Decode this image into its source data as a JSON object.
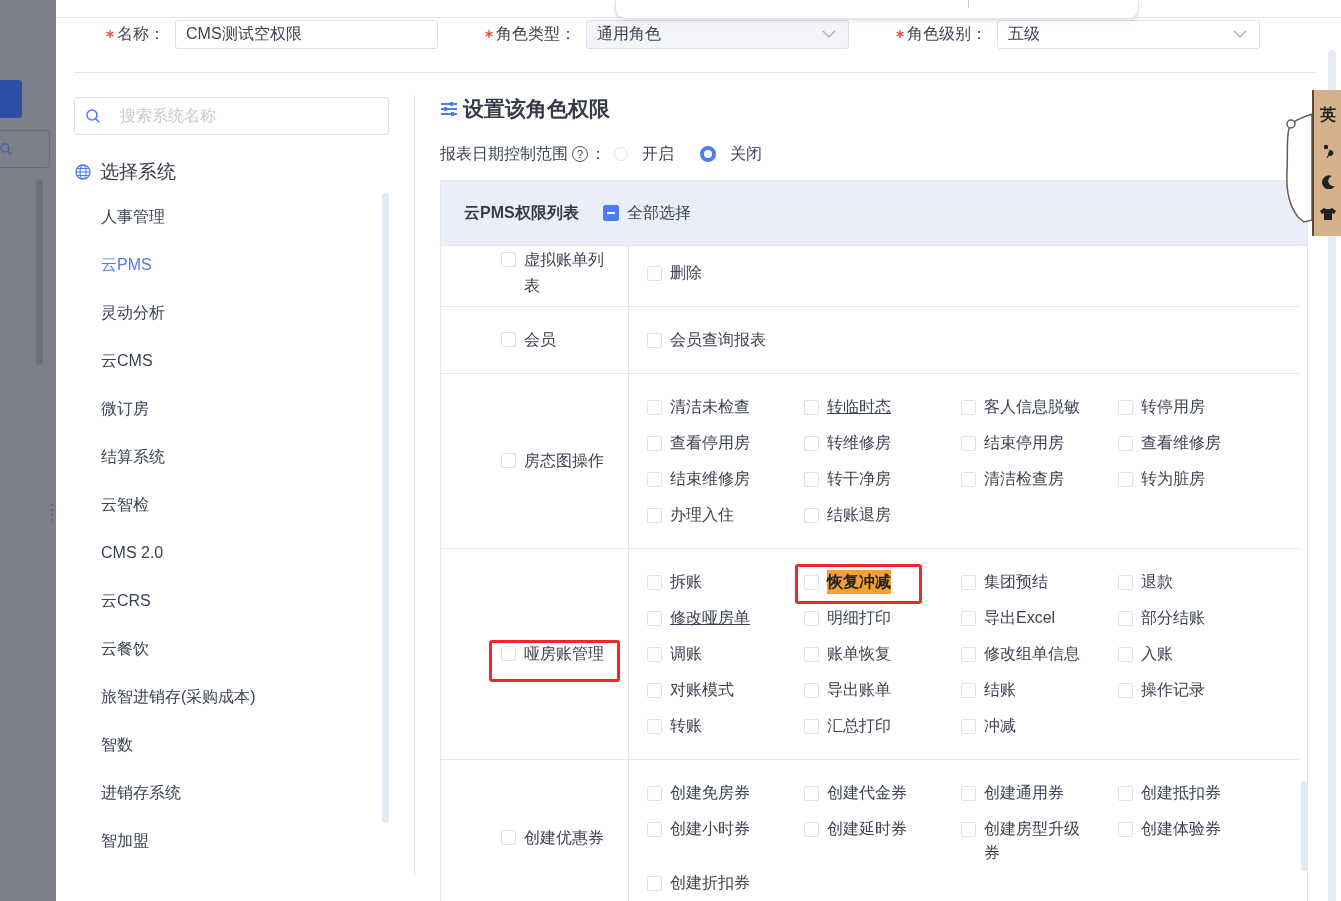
{
  "form": {
    "fields": [
      {
        "label": "名称：",
        "required": true,
        "kind": "input",
        "value": "CMS测试空权限",
        "disabled": false
      },
      {
        "label": "角色类型：",
        "required": true,
        "kind": "select",
        "value": "通用角色",
        "disabled": true
      },
      {
        "label": "角色级别：",
        "required": true,
        "kind": "select",
        "value": "五级",
        "disabled": false
      }
    ]
  },
  "system_panel": {
    "search": {
      "placeholder": "搜索系统名称"
    },
    "title": "选择系统",
    "items": [
      {
        "label": "人事管理",
        "selected": false
      },
      {
        "label": "云PMS",
        "selected": true
      },
      {
        "label": "灵动分析",
        "selected": false
      },
      {
        "label": "云CMS",
        "selected": false
      },
      {
        "label": "微订房",
        "selected": false
      },
      {
        "label": "结算系统",
        "selected": false
      },
      {
        "label": "云智检",
        "selected": false
      },
      {
        "label": "CMS 2.0",
        "selected": false
      },
      {
        "label": "云CRS",
        "selected": false
      },
      {
        "label": "云餐饮",
        "selected": false
      },
      {
        "label": "旅智进销存(采购成本)",
        "selected": false
      },
      {
        "label": "智数",
        "selected": false
      },
      {
        "label": "进销存系统",
        "selected": false
      },
      {
        "label": "智加盟",
        "selected": false
      }
    ]
  },
  "permissions": {
    "title": "设置该角色权限",
    "date_range": {
      "label": "报表日期控制范围",
      "help_icon": "?",
      "separator": "：",
      "options": [
        {
          "label": "开启",
          "selected": false
        },
        {
          "label": "关闭",
          "selected": true
        }
      ]
    },
    "table": {
      "title": "云PMS权限列表",
      "select_all": {
        "label": "全部选择",
        "indeterminate": true
      },
      "rows": [
        {
          "label": "虚拟账单列表",
          "checked": false,
          "annotated": false,
          "items": [
            {
              "label": "删除",
              "checked": false,
              "kind": "plain",
              "annotated": false
            }
          ]
        },
        {
          "label": "会员",
          "checked": false,
          "annotated": false,
          "items": [
            {
              "label": "会员查询报表",
              "checked": false,
              "kind": "plain",
              "annotated": false
            }
          ]
        },
        {
          "label": "房态图操作",
          "checked": false,
          "annotated": false,
          "items": [
            {
              "label": "清洁未检查",
              "checked": false,
              "kind": "plain",
              "annotated": false
            },
            {
              "label": "转临时态",
              "checked": false,
              "kind": "underlined",
              "annotated": false
            },
            {
              "label": "客人信息脱敏",
              "checked": false,
              "kind": "plain",
              "annotated": false
            },
            {
              "label": "转停用房",
              "checked": false,
              "kind": "plain",
              "annotated": false
            },
            {
              "label": "查看停用房",
              "checked": false,
              "kind": "plain",
              "annotated": false
            },
            {
              "label": "转维修房",
              "checked": false,
              "kind": "plain",
              "annotated": false
            },
            {
              "label": "结束停用房",
              "checked": false,
              "kind": "plain",
              "annotated": false
            },
            {
              "label": "查看维修房",
              "checked": false,
              "kind": "plain",
              "annotated": false
            },
            {
              "label": "结束维修房",
              "checked": false,
              "kind": "plain",
              "annotated": false
            },
            {
              "label": "转干净房",
              "checked": false,
              "kind": "plain",
              "annotated": false
            },
            {
              "label": "清洁检查房",
              "checked": false,
              "kind": "plain",
              "annotated": false
            },
            {
              "label": "转为脏房",
              "checked": false,
              "kind": "plain",
              "annotated": false
            },
            {
              "label": "办理入住",
              "checked": false,
              "kind": "plain",
              "annotated": false
            },
            {
              "label": "结账退房",
              "checked": false,
              "kind": "plain",
              "annotated": false
            }
          ]
        },
        {
          "label": "哑房账管理",
          "checked": false,
          "annotated": true,
          "items": [
            {
              "label": "拆账",
              "checked": false,
              "kind": "plain",
              "annotated": false
            },
            {
              "label": "恢复冲减",
              "checked": false,
              "kind": "highlighted",
              "annotated": true
            },
            {
              "label": "集团预结",
              "checked": false,
              "kind": "plain",
              "annotated": false
            },
            {
              "label": "退款",
              "checked": false,
              "kind": "plain",
              "annotated": false
            },
            {
              "label": "修改哑房单",
              "checked": false,
              "kind": "underlined",
              "annotated": false
            },
            {
              "label": "明细打印",
              "checked": false,
              "kind": "plain",
              "annotated": false
            },
            {
              "label": "导出Excel",
              "checked": false,
              "kind": "plain",
              "annotated": false
            },
            {
              "label": "部分结账",
              "checked": false,
              "kind": "plain",
              "annotated": false
            },
            {
              "label": "调账",
              "checked": false,
              "kind": "plain",
              "annotated": false
            },
            {
              "label": "账单恢复",
              "checked": false,
              "kind": "plain",
              "annotated": false
            },
            {
              "label": "修改组单信息",
              "checked": false,
              "kind": "plain",
              "annotated": false
            },
            {
              "label": "入账",
              "checked": false,
              "kind": "plain",
              "annotated": false
            },
            {
              "label": "对账模式",
              "checked": false,
              "kind": "plain",
              "annotated": false
            },
            {
              "label": "导出账单",
              "checked": false,
              "kind": "plain",
              "annotated": false
            },
            {
              "label": "结账",
              "checked": false,
              "kind": "plain",
              "annotated": false
            },
            {
              "label": "操作记录",
              "checked": false,
              "kind": "plain",
              "annotated": false
            },
            {
              "label": "转账",
              "checked": false,
              "kind": "plain",
              "annotated": false
            },
            {
              "label": "汇总打印",
              "checked": false,
              "kind": "plain",
              "annotated": false
            },
            {
              "label": "冲减",
              "checked": false,
              "kind": "plain",
              "annotated": false
            }
          ]
        },
        {
          "label": "创建优惠券",
          "checked": false,
          "annotated": false,
          "items": [
            {
              "label": "创建免房券",
              "checked": false,
              "kind": "plain",
              "annotated": false
            },
            {
              "label": "创建代金券",
              "checked": false,
              "kind": "plain",
              "annotated": false
            },
            {
              "label": "创建通用券",
              "checked": false,
              "kind": "plain",
              "annotated": false
            },
            {
              "label": "创建抵扣券",
              "checked": false,
              "kind": "plain",
              "annotated": false
            },
            {
              "label": "创建小时券",
              "checked": false,
              "kind": "plain",
              "annotated": false
            },
            {
              "label": "创建延时券",
              "checked": false,
              "kind": "plain",
              "annotated": false
            },
            {
              "label": "创建房型升级券",
              "checked": false,
              "kind": "plain",
              "annotated": false
            },
            {
              "label": "创建体验券",
              "checked": false,
              "kind": "plain",
              "annotated": false
            },
            {
              "label": "创建折扣券",
              "checked": false,
              "kind": "plain",
              "annotated": false
            }
          ]
        }
      ]
    }
  },
  "ime_toolbar": {
    "label": "英"
  }
}
